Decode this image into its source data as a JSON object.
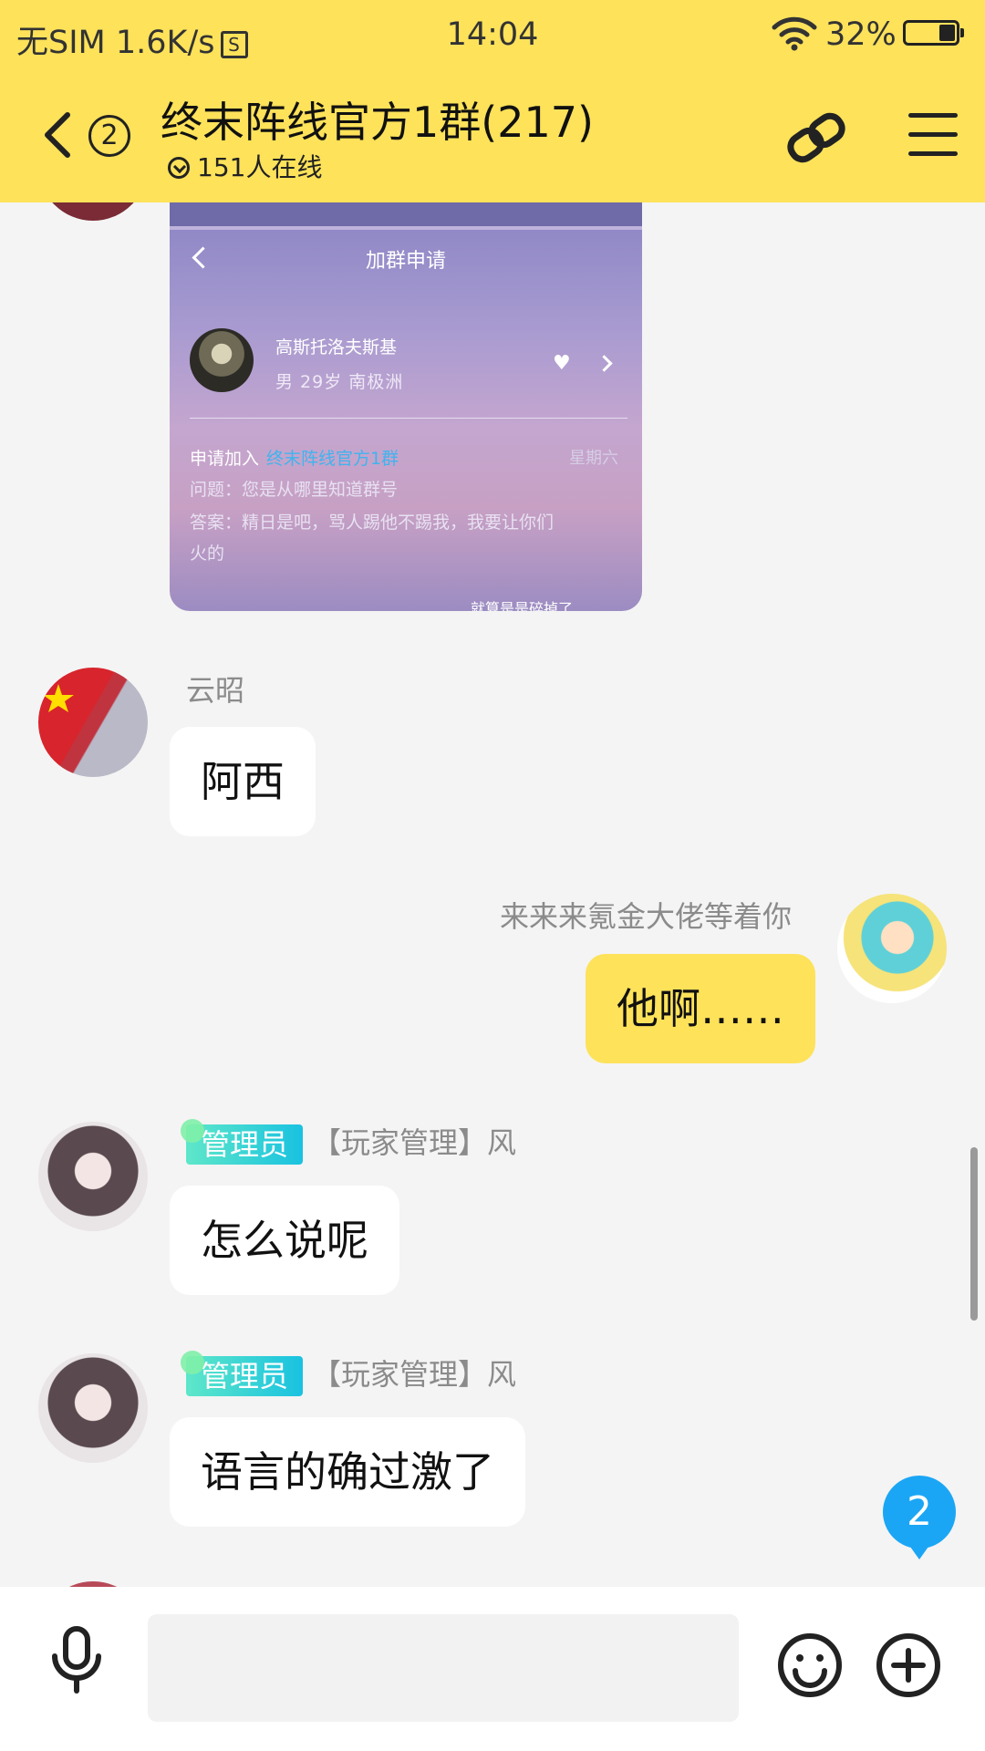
{
  "status_bar": {
    "carrier": "无SIM",
    "speed": "1.6K/s",
    "speed_icon": "S",
    "time": "14:04",
    "battery_percent": "32%",
    "battery_level": 0.32
  },
  "header": {
    "back_badge": "2",
    "title": "终末阵线官方1群(217)",
    "online": "151人在线"
  },
  "screenshot_card": {
    "title": "加群申请",
    "name": "高斯托洛夫斯基",
    "info": "男   29岁    南极洲",
    "apply_label": "申请加入",
    "apply_group": "终末阵线官方1群",
    "day": "星期六",
    "question": "问题：您是从哪里知道群号",
    "answer": "答案：精日是吧，骂人踢他不踢我，我要让你们火的",
    "footer": "就算是是碎掉了"
  },
  "messages": [
    {
      "sender": "云昭",
      "text": "阿西"
    },
    {
      "sender": "来来来氪金大佬等着你",
      "text": "他啊……"
    },
    {
      "badge": "管理员",
      "sender": "【玩家管理】风",
      "text": "怎么说呢"
    },
    {
      "badge": "管理员",
      "sender": "【玩家管理】风",
      "text": "语言的确过激了"
    }
  ],
  "unread_count": "2",
  "colors": {
    "header_bg": "#fde25a",
    "my_bubble": "#fde25a",
    "admin_badge": "#19c2e0",
    "unread_badge": "#1ba6f5"
  },
  "icons": [
    "back-arrow-icon",
    "link-icon",
    "menu-icon",
    "microphone-icon",
    "emoji-icon",
    "plus-icon",
    "wifi-icon",
    "battery-icon"
  ]
}
